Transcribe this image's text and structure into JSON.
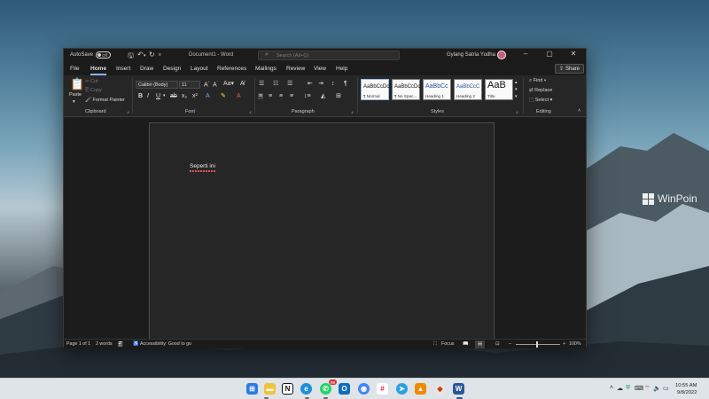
{
  "titlebar": {
    "autosave_label": "AutoSave",
    "autosave_state": "Off",
    "document_title": "Document1 - Word",
    "search_placeholder": "Search (Alt+Q)",
    "user_name": "Gylang Satria Yudha"
  },
  "menu": {
    "tabs": [
      "File",
      "Home",
      "Insert",
      "Draw",
      "Design",
      "Layout",
      "References",
      "Mailings",
      "Review",
      "View",
      "Help"
    ],
    "active_tab": "Home",
    "share_label": "Share"
  },
  "ribbon": {
    "clipboard": {
      "paste": "Paste",
      "cut": "Cut",
      "copy": "Copy",
      "format_painter": "Format Painter",
      "label": "Clipboard"
    },
    "font": {
      "font_name": "Calibri (Body)",
      "font_size": "11",
      "label": "Font"
    },
    "paragraph": {
      "label": "Paragraph"
    },
    "styles": {
      "label": "Styles",
      "items": [
        {
          "sample": "AaBbCcDc",
          "name": "¶ Normal"
        },
        {
          "sample": "AaBbCcDc",
          "name": "¶ No Spac..."
        },
        {
          "sample": "AaBbCc",
          "name": "Heading 1"
        },
        {
          "sample": "AaBbCcC",
          "name": "Heading 2"
        },
        {
          "sample": "AaB",
          "name": "Title"
        }
      ]
    },
    "editing": {
      "find": "Find",
      "replace": "Replace",
      "select": "Select",
      "label": "Editing"
    }
  },
  "document": {
    "text": "Seperti ini"
  },
  "statusbar": {
    "page": "Page 1 of 1",
    "words": "2 words",
    "accessibility": "Accessibility: Good to go",
    "focus": "Focus",
    "zoom": "100%",
    "zoom_fraction": 0.5
  },
  "desktop": {
    "watermark": "WinPoin"
  },
  "taskbar": {
    "apps": [
      "start",
      "file-explorer",
      "notion",
      "edge",
      "whatsapp",
      "outlook",
      "chrome",
      "slack",
      "telegram",
      "vlc",
      "office",
      "word"
    ],
    "whatsapp_badge": "99",
    "time": "10:55 AM",
    "date": "9/8/2022"
  },
  "colors": {
    "window_bg": "#1f1f1f",
    "ribbon_bg": "#262626",
    "accent": "#8ab4f8",
    "page_bg": "#262626",
    "taskbar_bg": "#dfe4e8",
    "spellcheck": "#e05555"
  }
}
